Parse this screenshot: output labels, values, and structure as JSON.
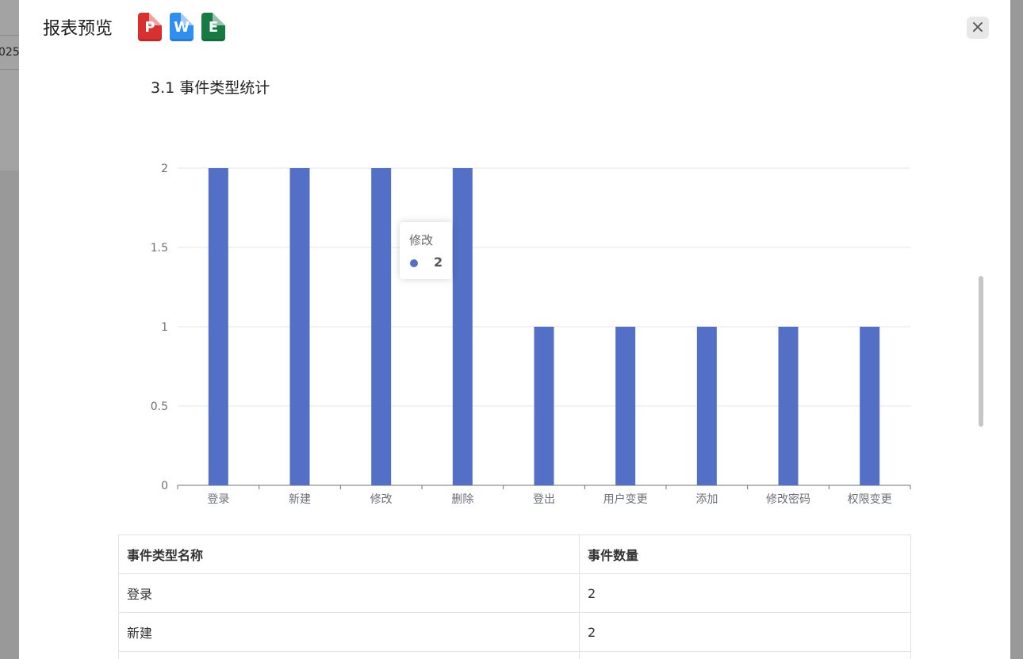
{
  "background": {
    "cell_text": "025-"
  },
  "modal": {
    "title": "报表预览",
    "export_icons": [
      {
        "label": "P",
        "color": "#d9302f",
        "name": "pdf-export-icon"
      },
      {
        "label": "W",
        "color": "#2e8ff0",
        "name": "word-export-icon"
      },
      {
        "label": "E",
        "color": "#177a43",
        "name": "excel-export-icon"
      }
    ],
    "close_symbol": "×"
  },
  "section": {
    "heading": "3.1 事件类型统计"
  },
  "chart_data": {
    "type": "bar",
    "categories": [
      "登录",
      "新建",
      "修改",
      "删除",
      "登出",
      "用户变更",
      "添加",
      "修改密码",
      "权限变更"
    ],
    "values": [
      2,
      2,
      2,
      2,
      1,
      1,
      1,
      1,
      1
    ],
    "ylim": [
      0,
      2
    ],
    "yticks": [
      "0",
      "0.5",
      "1",
      "1.5",
      "2"
    ],
    "grid": true,
    "bar_color": "#5470c6",
    "tooltip": {
      "category": "修改",
      "value": "2"
    }
  },
  "table": {
    "headers": [
      "事件类型名称",
      "事件数量"
    ],
    "rows": [
      [
        "登录",
        "2"
      ],
      [
        "新建",
        "2"
      ],
      [
        "",
        ""
      ]
    ]
  }
}
